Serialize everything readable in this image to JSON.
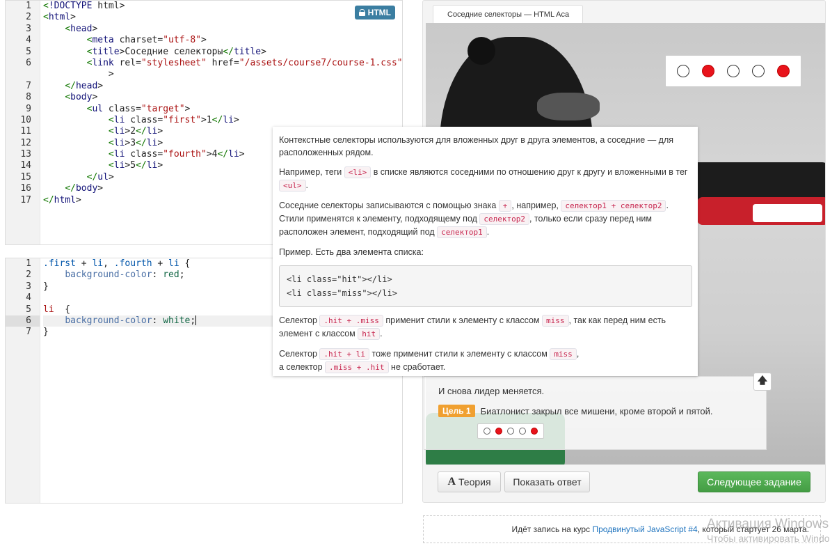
{
  "html_editor": {
    "badge_label": "HTML",
    "line_numbers": [
      "1",
      "2",
      "3",
      "4",
      "5",
      "6",
      "",
      "7",
      "8",
      "9",
      "10",
      "11",
      "12",
      "13",
      "14",
      "15",
      "16",
      "17"
    ],
    "lines": [
      "<!DOCTYPE html>",
      "<html>",
      "    <head>",
      "        <meta charset=\"utf-8\">",
      "        <title>Соседние селекторы</title>",
      "        <link rel=\"stylesheet\" href=\"/assets/course7/course-1.css\"",
      "            >",
      "    </head>",
      "    <body>",
      "        <ul class=\"target\">",
      "            <li class=\"first\">1</li>",
      "            <li>2</li>",
      "            <li>3</li>",
      "            <li class=\"fourth\">4</li>",
      "            <li>5</li>",
      "        </ul>",
      "    </body>",
      "</html>"
    ]
  },
  "css_editor": {
    "line_numbers": [
      "1",
      "2",
      "3",
      "4",
      "5",
      "6",
      "7"
    ],
    "lines": [
      ".first + li, .fourth + li {",
      "    background-color: red;",
      "}",
      "",
      "li  {",
      "    background-color: white;",
      "}"
    ]
  },
  "preview": {
    "tab_title": "Соседние селекторы — HTML Aca",
    "targets": [
      false,
      true,
      false,
      false,
      true
    ]
  },
  "task": {
    "title": "И снова лидер меняется.",
    "goal_badge": "Цель 1",
    "goal_text": "Биатлонист закрыл все мишени, кроме второй и пятой.",
    "up_arrow": "🡅",
    "mini_targets": [
      false,
      true,
      false,
      false,
      true
    ]
  },
  "buttons": {
    "theory_icon": "A",
    "theory": "Теория",
    "show_answer": "Показать ответ",
    "next": "Следующее задание"
  },
  "theory": {
    "p1": "Контекстные селекторы используются для вложенных друг в друга элементов, а соседние — для расположенных рядом.",
    "p2_a": "Например, теги",
    "p2_chip1": "<li>",
    "p2_b": "в списке являются соседними по отношению друг к другу и вложенными в тег",
    "p2_chip2": "<ul>",
    "p2_c": ".",
    "p3_a": "Соседние селекторы записываются с помощью знака",
    "p3_chip1": "+",
    "p3_b": ", например,",
    "p3_chip2": "селектор1 + селектор2",
    "p3_c": ". Стили применятся к элементу, подходящему под",
    "p3_chip3": "селектор2",
    "p3_d": ", только если сразу перед ним расположен элемент, подходящий под",
    "p3_chip4": "селектор1",
    "p3_e": ".",
    "p4": "Пример. Есть два элемента списка:",
    "code": "<li class=\"hit\"></li>\n<li class=\"miss\"></li>",
    "p5_a": "Селектор",
    "p5_chip1": ".hit + .miss",
    "p5_b": "применит стили к элементу с классом",
    "p5_chip2": "miss",
    "p5_c": ", так как перед ним есть элемент с классом",
    "p5_chip3": "hit",
    "p5_d": ".",
    "p6_a": "Селектор",
    "p6_chip1": ".hit + li",
    "p6_b": "тоже применит стили к элементу с классом",
    "p6_chip2": "miss",
    "p6_c": ",",
    "p6_d": "а селектор",
    "p6_chip3": ".miss + .hit",
    "p6_e": "не сработает."
  },
  "footer": {
    "text_before": "Идёт запись на курс",
    "link": "Продвинутый JavaScript #4",
    "text_after": ", который стартует 26 марта."
  },
  "watermark": {
    "line1": "Активация Windows",
    "line2": "Чтобы активировать Windo"
  },
  "colors": {
    "accent": "#3b7ea1",
    "hit": "#e8131b",
    "goal": "#f0a030",
    "next": "#5cb85c"
  }
}
